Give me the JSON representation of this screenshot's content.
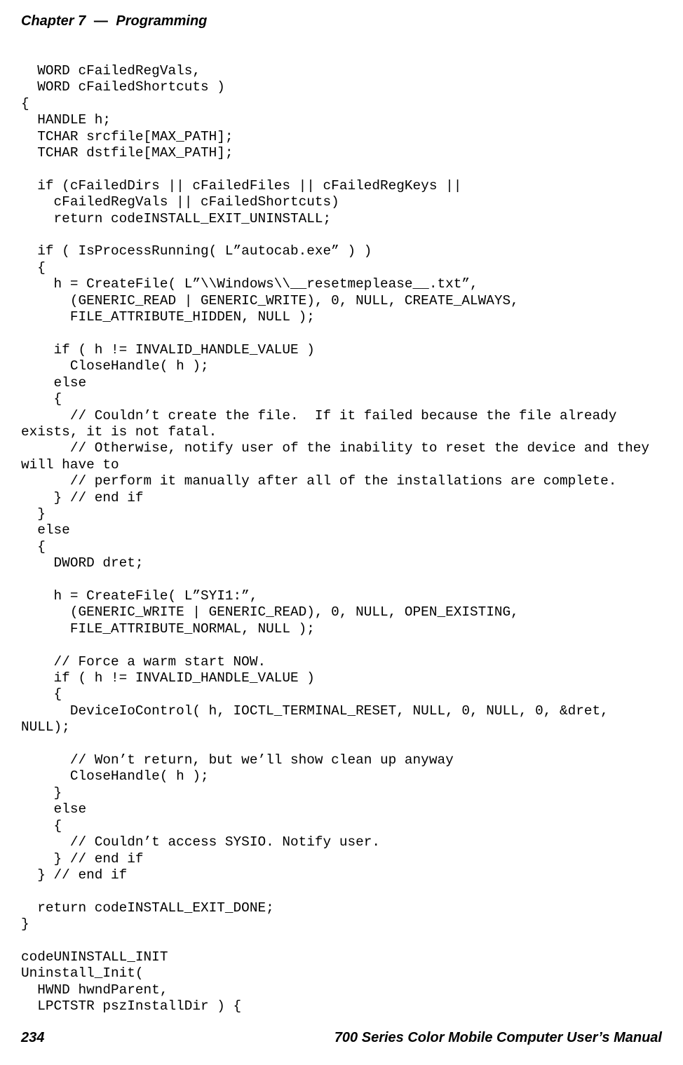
{
  "header": {
    "chapter": "Chapter 7",
    "dash": "—",
    "title": "Programming"
  },
  "code": "  WORD cFailedRegVals,\n  WORD cFailedShortcuts )\n{\n  HANDLE h;\n  TCHAR srcfile[MAX_PATH];\n  TCHAR dstfile[MAX_PATH];\n\n  if (cFailedDirs || cFailedFiles || cFailedRegKeys ||\n    cFailedRegVals || cFailedShortcuts)\n    return codeINSTALL_EXIT_UNINSTALL;\n\n  if ( IsProcessRunning( L”autocab.exe” ) )\n  {\n    h = CreateFile( L”\\\\Windows\\\\__resetmeplease__.txt”,\n      (GENERIC_READ | GENERIC_WRITE), 0, NULL, CREATE_ALWAYS,\n      FILE_ATTRIBUTE_HIDDEN, NULL );\n\n    if ( h != INVALID_HANDLE_VALUE )\n      CloseHandle( h );\n    else\n    {\n      // Couldn’t create the file.  If it failed because the file already\nexists, it is not fatal.\n      // Otherwise, notify user of the inability to reset the device and they\nwill have to\n      // perform it manually after all of the installations are complete.\n    } // end if\n  }\n  else\n  {\n    DWORD dret;\n\n    h = CreateFile( L”SYI1:”,\n      (GENERIC_WRITE | GENERIC_READ), 0, NULL, OPEN_EXISTING,\n      FILE_ATTRIBUTE_NORMAL, NULL );\n\n    // Force a warm start NOW.\n    if ( h != INVALID_HANDLE_VALUE )\n    {\n      DeviceIoControl( h, IOCTL_TERMINAL_RESET, NULL, 0, NULL, 0, &dret,\nNULL);\n\n      // Won’t return, but we’ll show clean up anyway\n      CloseHandle( h );\n    }\n    else\n    {\n      // Couldn’t access SYSIO. Notify user.\n    } // end if\n  } // end if\n\n  return codeINSTALL_EXIT_DONE;\n}\n\ncodeUNINSTALL_INIT\nUninstall_Init(\n  HWND hwndParent,\n  LPCTSTR pszInstallDir ) {",
  "footer": {
    "page": "234",
    "manual": "700 Series Color Mobile Computer User’s Manual"
  }
}
